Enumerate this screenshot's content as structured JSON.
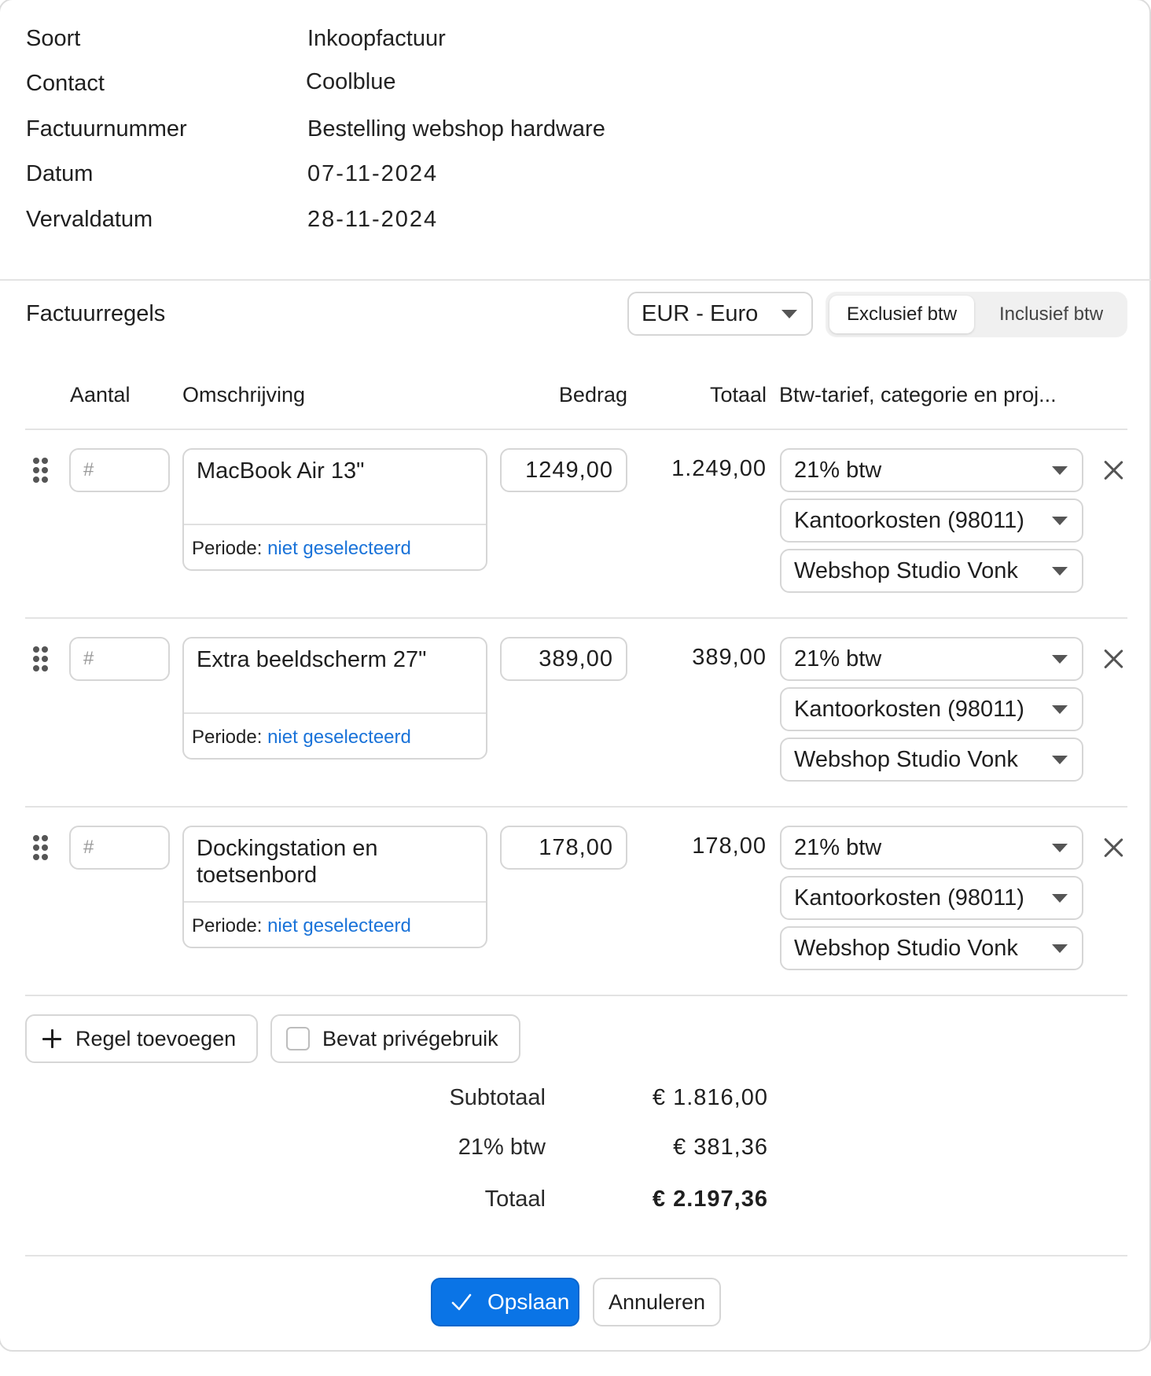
{
  "header": {
    "fields": [
      {
        "label": "Soort",
        "value": "Inkoopfactuur"
      },
      {
        "label": "Contact",
        "value": "Coolblue"
      },
      {
        "label": "Factuurnummer",
        "value": "Bestelling webshop hardware"
      },
      {
        "label": "Datum",
        "value": "07-11-2024"
      },
      {
        "label": "Vervaldatum",
        "value": "28-11-2024"
      }
    ]
  },
  "lines_section": {
    "title": "Factuurregels",
    "currency": "EUR - Euro",
    "tax_toggle": {
      "options": [
        "Exclusief btw",
        "Inclusief btw"
      ],
      "selected": "Exclusief btw"
    },
    "columns": {
      "aantal": "Aantal",
      "omschrijving": "Omschrijving",
      "bedrag": "Bedrag",
      "totaal": "Totaal",
      "btw": "Btw-tarief, categorie en proj..."
    }
  },
  "lines": [
    {
      "qty_placeholder": "#",
      "description": "MacBook Air 13\"",
      "periode_label": "Periode:",
      "periode_link": "niet geselecteerd",
      "amount": "1249,00",
      "total": "1.249,00",
      "vat": "21% btw",
      "category": "Kantoorkosten (98011)",
      "project": "Webshop Studio Vonk"
    },
    {
      "qty_placeholder": "#",
      "description": "Extra beeldscherm 27\"",
      "periode_label": "Periode:",
      "periode_link": "niet geselecteerd",
      "amount": "389,00",
      "total": "389,00",
      "vat": "21% btw",
      "category": "Kantoorkosten (98011)",
      "project": "Webshop Studio Vonk"
    },
    {
      "qty_placeholder": "#",
      "description": "Dockingstation en toetsenbord",
      "periode_label": "Periode:",
      "periode_link": "niet geselecteerd",
      "amount": "178,00",
      "total": "178,00",
      "vat": "21% btw",
      "category": "Kantoorkosten (98011)",
      "project": "Webshop Studio Vonk"
    }
  ],
  "actions": {
    "add_line": "Regel toevoegen",
    "private_use": "Bevat privégebruik",
    "private_use_checked": false
  },
  "summary": {
    "subtotal_label": "Subtotaal",
    "subtotal_value": "€ 1.816,00",
    "vat_label": "21% btw",
    "vat_value": "€ 381,36",
    "total_label": "Totaal",
    "total_value": "€ 2.197,36"
  },
  "footer": {
    "save": "Opslaan",
    "cancel": "Annuleren"
  },
  "colors": {
    "primary": "#0a74e6",
    "link": "#1a73d9",
    "border": "#d6d6d6"
  }
}
